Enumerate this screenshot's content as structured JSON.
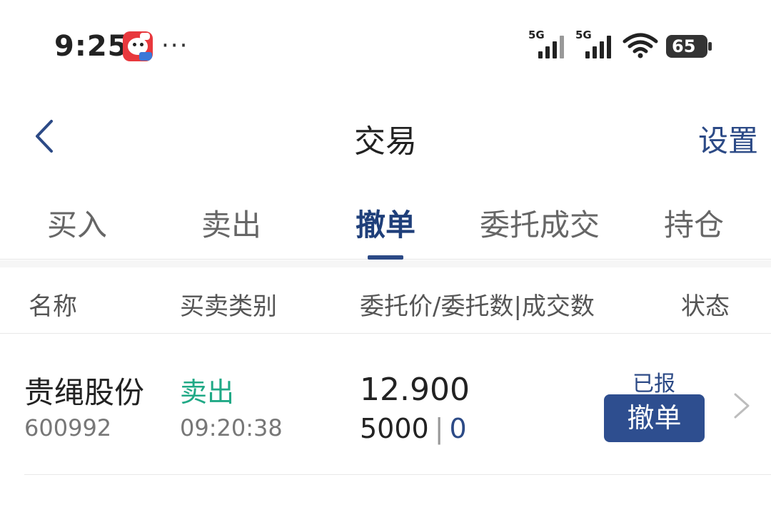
{
  "status_bar": {
    "time": "9:25",
    "more": "···",
    "signal1_label": "5G",
    "signal2_label": "5G",
    "battery": "65",
    "icons": [
      "app-notification-icon",
      "signal-icon",
      "signal-icon",
      "wifi-icon",
      "battery-icon"
    ]
  },
  "nav": {
    "title": "交易",
    "settings_label": "设置",
    "back_icon": "chevron-left-icon"
  },
  "tabs": [
    {
      "label": "买入",
      "active": false
    },
    {
      "label": "卖出",
      "active": false
    },
    {
      "label": "撤单",
      "active": true
    },
    {
      "label": "委托成交",
      "active": false
    },
    {
      "label": "持仓",
      "active": false
    }
  ],
  "list_header": {
    "name": "名称",
    "type": "买卖类别",
    "price_qty": "委托价/委托数|成交数",
    "status": "状态"
  },
  "orders": [
    {
      "name": "贵绳股份",
      "code": "600992",
      "type": "卖出",
      "time": "09:20:38",
      "price": "12.900",
      "qty": "5000",
      "separator": "|",
      "filled": "0",
      "status": "已报",
      "action_label": "撤单"
    }
  ],
  "colors": {
    "accent": "#2c4a86",
    "sell_green": "#20a986",
    "button_bg": "#2e4e8f"
  }
}
